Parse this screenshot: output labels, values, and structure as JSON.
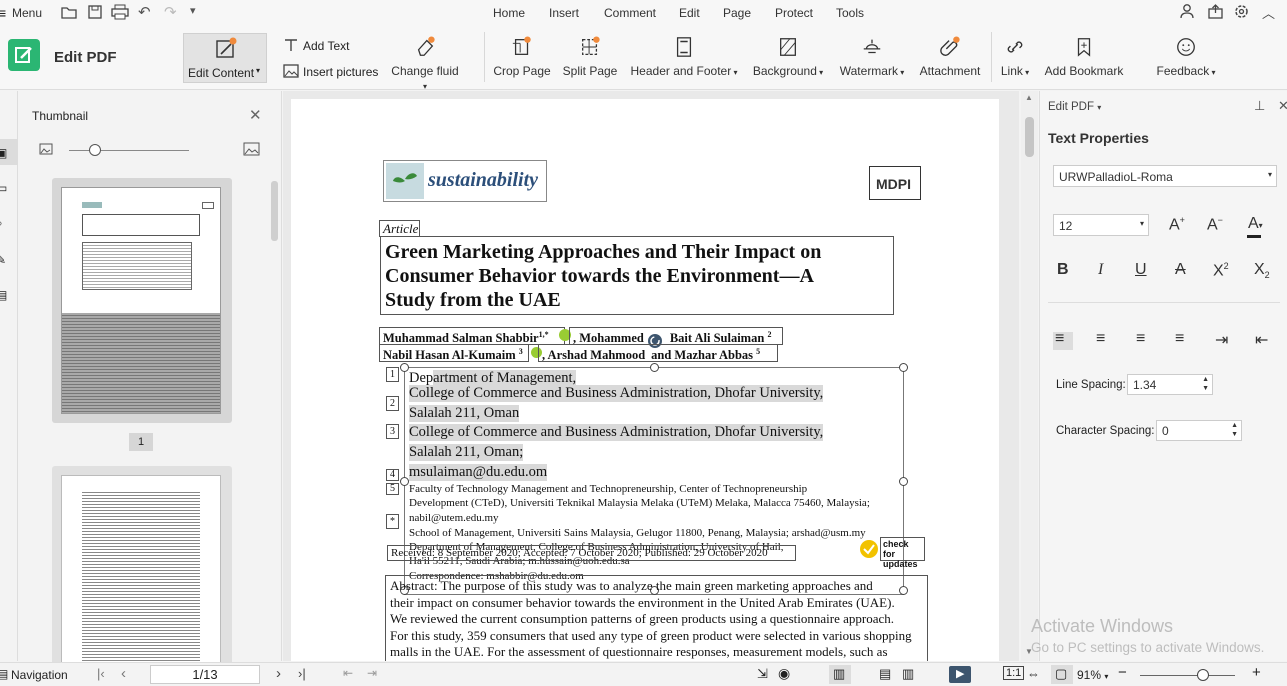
{
  "menubar": {
    "menu_label": "Menu",
    "tabs": [
      "Home",
      "Insert",
      "Comment",
      "Edit",
      "Page",
      "Protect",
      "Tools"
    ]
  },
  "ribbon": {
    "mode_title": "Edit PDF",
    "buttons": {
      "edit_content": "Edit Content",
      "add_text": "Add Text",
      "insert_pictures": "Insert pictures",
      "change_fluid": "Change fluid",
      "crop_page": "Crop Page",
      "split_page": "Split Page",
      "header_footer": "Header and Footer",
      "background": "Background",
      "watermark": "Watermark",
      "attachment": "Attachment",
      "link": "Link",
      "add_bookmark": "Add Bookmark",
      "feedback": "Feedback"
    },
    "accent": "#2bb673"
  },
  "thumbnail": {
    "title": "Thumbnail",
    "page1_label": "1"
  },
  "document": {
    "journal": "sustainability",
    "publisher": "MDPI",
    "article_type": "Article",
    "title_lines": [
      "Green Marketing Approaches and Their Impact on",
      "Consumer Behavior towards the Environment—A",
      "Study from the UAE"
    ],
    "authors_line1": "Muhammad Salman Shabbir",
    "authors_line1_sup": "1,*",
    "authors_line1b": ", Mohammed",
    "authors_line1c": "Bait Ali Sulaiman",
    "authors_line1c_sup": "2",
    "authors_line2a": "Nabil Hasan Al-Kumaim",
    "authors_line2a_sup": "3",
    "authors_line2b": ", Arshad Mahmood",
    "authors_line2c": "and Mazhar Abbas",
    "authors_line2c_sup": "5",
    "aff_numbers": [
      "1",
      "2",
      "3",
      "4",
      "5",
      "*"
    ],
    "aff1_a": "Dep",
    "aff1_b": "artment of Management,",
    "aff1_line2": "College of Commerce and Business Administration, Dhofar University,",
    "aff1_line3": "Salalah 211, Oman",
    "aff2_line1": "College of Commerce and Business Administration, Dhofar University,",
    "aff2_line2": "Salalah 211, Oman;",
    "aff2_line3": "msulaiman@du.edu.om",
    "aff3_line1": "Faculty of Technology Management and Technopreneurship, Center of Technopreneurship",
    "aff3_line2": "Development (CTeD), Universiti Teknikal Malaysia Melaka (UTeM) Melaka, Malacca 75460, Malaysia;",
    "aff3_line3": "nabil@utem.edu.my",
    "aff4_line1": "School of Management, Universiti Sains Malaysia, Gelugor 11800, Penang, Malaysia; arshad@usm.my",
    "aff5_line1": "Department of Management, College of Business Administration, University of Hail,",
    "aff5_line2": "Ha'il 55211, Saudi Arabia; m.hussain@uoh.edu.sa",
    "correspondence": "Correspondence: mshabbir@du.edu.om",
    "received": "Received: 8 September 2020; Accepted: 7 October 2020; Published: 29 October 2020",
    "check_updates_1": "check for",
    "check_updates_2": "updates",
    "abstract_lines": [
      "Abstract: The purpose of this study was to analyze the main green marketing approaches and",
      "their impact on consumer behavior towards the environment in the United Arab Emirates (UAE).",
      "We reviewed the current consumption patterns of green products using a questionnaire approach.",
      "For this study, 359 consumers that used any type of green product were selected in various shopping",
      "malls in the UAE. For the assessment of questionnaire responses, measurement models, such as"
    ]
  },
  "rightpanel": {
    "header": "Edit PDF",
    "section_title": "Text Properties",
    "font_name": "URWPalladioL-Roma",
    "font_size": "12",
    "line_spacing_label": "Line Spacing:",
    "line_spacing_value": "1.34",
    "char_spacing_label": "Character Spacing:",
    "char_spacing_value": "0"
  },
  "status": {
    "navigation_label": "Navigation",
    "page_indicator": "1/13",
    "zoom": "91%",
    "zoom_level": 0.66
  },
  "watermark": {
    "line1": "Activate Windows",
    "line2": "Go to PC settings to activate Windows."
  }
}
